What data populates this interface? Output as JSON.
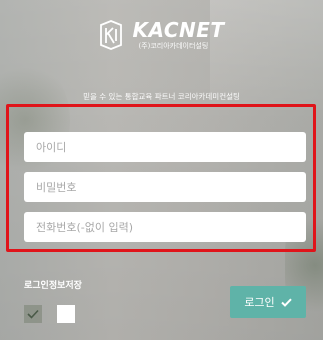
{
  "header": {
    "brand_name": "KACNET",
    "brand_sub": "(주)코리아카데이터설팅",
    "tagline": "믿을 수 있는 통합교육 파트너 코리아카데미컨설팅"
  },
  "form": {
    "id_placeholder": "아이디",
    "password_placeholder": "비밀번호",
    "phone_placeholder": "전화번호(-없이 입력)",
    "remember_label": "로그인정보저장",
    "login_label": "로그인"
  },
  "colors": {
    "highlight_border": "#e0141a",
    "login_button": "#5fb3a8"
  },
  "icons": {
    "logo": "kacnet-logo-icon",
    "login": "checkmark-icon",
    "remember": "checkmark-icon"
  }
}
